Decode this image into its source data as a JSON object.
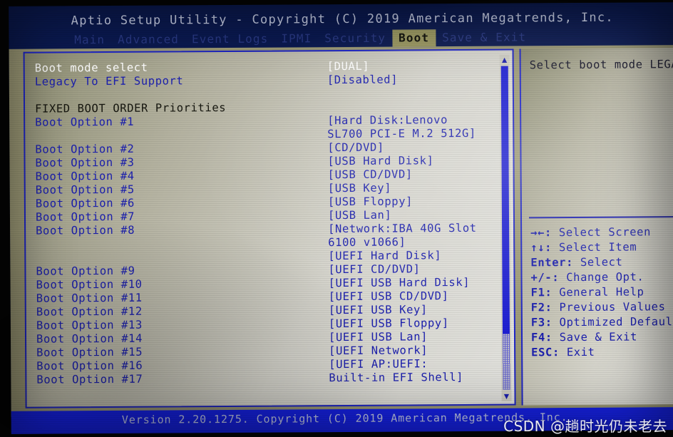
{
  "title": "Aptio Setup Utility - Copyright (C) 2019 American Megatrends, Inc.",
  "menu": {
    "tabs": [
      {
        "label": "Main",
        "selected": false
      },
      {
        "label": "Advanced",
        "selected": false
      },
      {
        "label": "Event Logs",
        "selected": false
      },
      {
        "label": "IPMI",
        "selected": false
      },
      {
        "label": "Security",
        "selected": false
      },
      {
        "label": "Boot",
        "selected": true
      },
      {
        "label": "Save & Exit",
        "selected": false
      }
    ]
  },
  "settings": {
    "labels": [
      {
        "text": "Boot mode select",
        "style": "white"
      },
      {
        "text": "Legacy To EFI Support",
        "style": "blue"
      },
      {
        "text": "",
        "style": "blank"
      },
      {
        "text": "FIXED BOOT ORDER Priorities",
        "style": "black"
      },
      {
        "text": "Boot Option #1",
        "style": "blue"
      },
      {
        "text": "",
        "style": "blank"
      },
      {
        "text": "Boot Option #2",
        "style": "blue"
      },
      {
        "text": "Boot Option #3",
        "style": "blue"
      },
      {
        "text": "Boot Option #4",
        "style": "blue"
      },
      {
        "text": "Boot Option #5",
        "style": "blue"
      },
      {
        "text": "Boot Option #6",
        "style": "blue"
      },
      {
        "text": "Boot Option #7",
        "style": "blue"
      },
      {
        "text": "Boot Option #8",
        "style": "blue"
      },
      {
        "text": "",
        "style": "blank"
      },
      {
        "text": "",
        "style": "blank"
      },
      {
        "text": "Boot Option #9",
        "style": "blue"
      },
      {
        "text": "Boot Option #10",
        "style": "blue"
      },
      {
        "text": "Boot Option #11",
        "style": "blue"
      },
      {
        "text": "Boot Option #12",
        "style": "blue"
      },
      {
        "text": "Boot Option #13",
        "style": "blue"
      },
      {
        "text": "Boot Option #14",
        "style": "blue"
      },
      {
        "text": "Boot Option #15",
        "style": "blue"
      },
      {
        "text": "Boot Option #16",
        "style": "blue"
      },
      {
        "text": "Boot Option #17",
        "style": "blue"
      }
    ],
    "values": [
      {
        "text": "[DUAL]",
        "style": "white"
      },
      {
        "text": "[Disabled]",
        "style": "blue"
      },
      {
        "text": "",
        "style": "blank"
      },
      {
        "text": "",
        "style": "blank"
      },
      {
        "text": "[Hard Disk:Lenovo",
        "style": "blue"
      },
      {
        "text": "SL700 PCI-E M.2 512G]",
        "style": "blue"
      },
      {
        "text": "[CD/DVD]",
        "style": "blue"
      },
      {
        "text": "[USB Hard Disk]",
        "style": "blue"
      },
      {
        "text": "[USB CD/DVD]",
        "style": "blue"
      },
      {
        "text": "[USB Key]",
        "style": "blue"
      },
      {
        "text": "[USB Floppy]",
        "style": "blue"
      },
      {
        "text": "[USB Lan]",
        "style": "blue"
      },
      {
        "text": "[Network:IBA 40G Slot",
        "style": "blue"
      },
      {
        "text": "6100 v1066]",
        "style": "blue"
      },
      {
        "text": "[UEFI Hard Disk]",
        "style": "blue"
      },
      {
        "text": "[UEFI CD/DVD]",
        "style": "blue"
      },
      {
        "text": "[UEFI USB Hard Disk]",
        "style": "blue"
      },
      {
        "text": "[UEFI USB CD/DVD]",
        "style": "blue"
      },
      {
        "text": "[UEFI USB Key]",
        "style": "blue"
      },
      {
        "text": "[UEFI USB Floppy]",
        "style": "blue"
      },
      {
        "text": "[UEFI USB Lan]",
        "style": "blue"
      },
      {
        "text": "[UEFI Network]",
        "style": "blue"
      },
      {
        "text": "[UEFI AP:UEFI:",
        "style": "blue"
      },
      {
        "text": "Built-in EFI Shell]",
        "style": "blue"
      }
    ]
  },
  "scrollbar": {
    "up_arrow": "▲",
    "down_arrow": "▼"
  },
  "help": {
    "text": "Select boot mode LEGA",
    "shortcuts": [
      {
        "key": "→←:",
        "action": "Select Screen"
      },
      {
        "key": "↑↓:",
        "action": "Select Item"
      },
      {
        "key": "Enter:",
        "action": "Select"
      },
      {
        "key": "+/-:",
        "action": "Change Opt."
      },
      {
        "key": "F1:",
        "action": "General Help"
      },
      {
        "key": "F2:",
        "action": "Previous Values"
      },
      {
        "key": "F3:",
        "action": "Optimized Defaults"
      },
      {
        "key": "F4:",
        "action": "Save & Exit"
      },
      {
        "key": "ESC:",
        "action": "Exit"
      }
    ]
  },
  "footer": {
    "text": "Version 2.20.1275. Copyright (C) 2019 American Megatrends, Inc."
  },
  "watermark": {
    "text": "CSDN @趟时光仍未老去"
  },
  "colors": {
    "title_bar_bg": "#0b1a52",
    "panel_bg": "#b4b2a0",
    "accent_blue": "#1b1fae",
    "selected_tab_bg": "#9d9a62",
    "footer_bg": "#1622e8"
  }
}
